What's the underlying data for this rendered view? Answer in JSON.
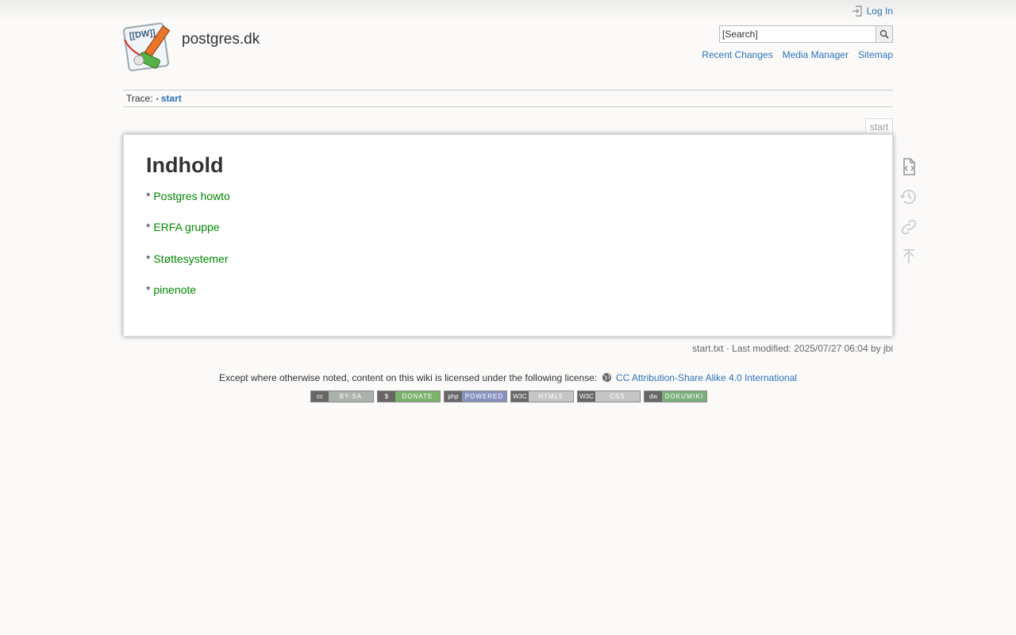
{
  "header": {
    "site_title": "postgres.dk",
    "login_label": "Log In",
    "search_placeholder": "[Search]",
    "search_button_label": "Search",
    "tools": [
      "Recent Changes",
      "Media Manager",
      "Sitemap"
    ]
  },
  "breadcrumbs": {
    "label": "Trace:",
    "separator": "•",
    "current": "start"
  },
  "page": {
    "tab_label": "start",
    "heading": "Indhold",
    "bullet": "*",
    "links": [
      "Postgres howto",
      "ERFA gruppe",
      "Støttesystemer",
      "pinenote"
    ]
  },
  "page_tools": [
    {
      "name": "show-source",
      "icon": "code-file-icon"
    },
    {
      "name": "old-revisions",
      "icon": "history-icon"
    },
    {
      "name": "backlinks",
      "icon": "link-icon"
    },
    {
      "name": "back-to-top",
      "icon": "arrow-up-icon"
    }
  ],
  "docinfo": {
    "text": "start.txt · Last modified: 2025/07/27 06:04 by jbi"
  },
  "footer": {
    "license_text": "Except where otherwise noted, content on this wiki is licensed under the following license:",
    "license_link": "CC Attribution-Share Alike 4.0 International",
    "badges": [
      {
        "left": "cc",
        "right": "BY-SA",
        "color": "#aab2ab"
      },
      {
        "left": "$",
        "right": "DONATE",
        "color": "#7cb36a"
      },
      {
        "left": "php",
        "right": "POWERED",
        "color": "#8892bf"
      },
      {
        "left": "W3C",
        "right": "HTML5",
        "color": "#c6c6c6"
      },
      {
        "left": "W3C",
        "right": "CSS",
        "color": "#c6c6c6"
      },
      {
        "left": "dw",
        "right": "DOKUWIKI",
        "color": "#7bb07b"
      }
    ]
  }
}
